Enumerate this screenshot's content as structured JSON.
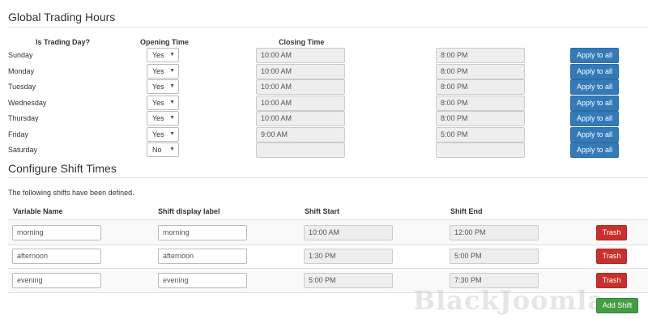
{
  "trading": {
    "title": "Global Trading Hours",
    "headers": {
      "is_trading_day": "Is Trading Day?",
      "opening": "Opening Time",
      "closing": "Closing Time"
    },
    "days": [
      {
        "name": "Sunday",
        "trading": "Yes",
        "open": "10:00 AM",
        "close": "8:00 PM",
        "apply": "Apply to all"
      },
      {
        "name": "Monday",
        "trading": "Yes",
        "open": "10:00 AM",
        "close": "8:00 PM",
        "apply": "Apply to all"
      },
      {
        "name": "Tuesday",
        "trading": "Yes",
        "open": "10:00 AM",
        "close": "8:00 PM",
        "apply": "Apply to all"
      },
      {
        "name": "Wednesday",
        "trading": "Yes",
        "open": "10:00 AM",
        "close": "8:00 PM",
        "apply": "Apply to all"
      },
      {
        "name": "Thursday",
        "trading": "Yes",
        "open": "10:00 AM",
        "close": "8:00 PM",
        "apply": "Apply to all"
      },
      {
        "name": "Friday",
        "trading": "Yes",
        "open": "9:00 AM",
        "close": "5:00 PM",
        "apply": "Apply to all"
      },
      {
        "name": "Saturday",
        "trading": "No",
        "open": "",
        "close": "",
        "apply": "Apply to all"
      }
    ]
  },
  "shifts": {
    "title": "Configure Shift Times",
    "description": "The following shifts have been defined.",
    "headers": {
      "variable": "Variable Name",
      "label": "Shift display label",
      "start": "Shift Start",
      "end": "Shift End"
    },
    "rows": [
      {
        "variable": "morning",
        "label": "morning",
        "start": "10:00 AM",
        "end": "12:00 PM",
        "trash": "Trash"
      },
      {
        "variable": "afternoon",
        "label": "afternoon",
        "start": "1:30 PM",
        "end": "5:00 PM",
        "trash": "Trash"
      },
      {
        "variable": "evening",
        "label": "evening",
        "start": "5:00 PM",
        "end": "7:30 PM",
        "trash": "Trash"
      }
    ],
    "add_label": "Add Shift"
  },
  "watermark": "BlackJoomla",
  "colors": {
    "primary": "#337ab7",
    "danger": "#c9302c",
    "success": "#449d44",
    "readonly_bg": "#eeeeee"
  }
}
